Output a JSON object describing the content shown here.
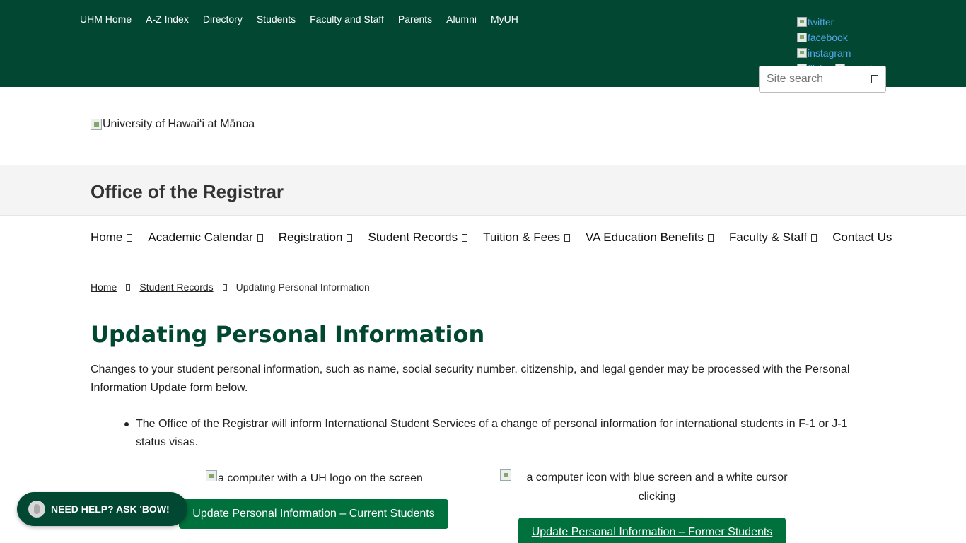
{
  "top_links": [
    "UHM Home",
    "A-Z Index",
    "Directory",
    "Students",
    "Faculty and Staff",
    "Parents",
    "Alumni",
    "MyUH"
  ],
  "social": {
    "twitter": "twitter",
    "facebook": "facebook",
    "instagram": "instagram",
    "flickr": "flickr",
    "youtube": "youtube"
  },
  "search": {
    "placeholder": "Site search"
  },
  "logo_alt": "University of Hawaiʻi at Mānoa",
  "site_title": "Office of the Registrar",
  "main_nav": [
    "Home",
    "Academic Calendar",
    "Registration",
    "Student Records",
    "Tuition & Fees",
    "VA Education Benefits",
    "Faculty & Staff",
    "Contact Us"
  ],
  "breadcrumb": {
    "home": "Home",
    "section": "Student Records",
    "current": "Updating Personal Information"
  },
  "page_title": "Updating Personal Information",
  "intro": "Changes to your student personal information, such as name, social security number, citizenship, and legal gender may be processed with the Personal Information Update form below.",
  "bullet": "The Office of the Registrar will inform International Student Services of a change of personal information for international students in F-1 or J-1 status visas.",
  "image1_alt": "a computer with a UH logo on the screen",
  "image2_alt": "a computer icon with blue screen and a white cursor clicking",
  "button_current": "Update Personal Information – Current Students",
  "button_former": "Update Personal Information – Former Students",
  "help_button": "NEED HELP? ASK 'BOW!",
  "colors": {
    "uh_green": "#024731",
    "button_green": "#00703c"
  }
}
